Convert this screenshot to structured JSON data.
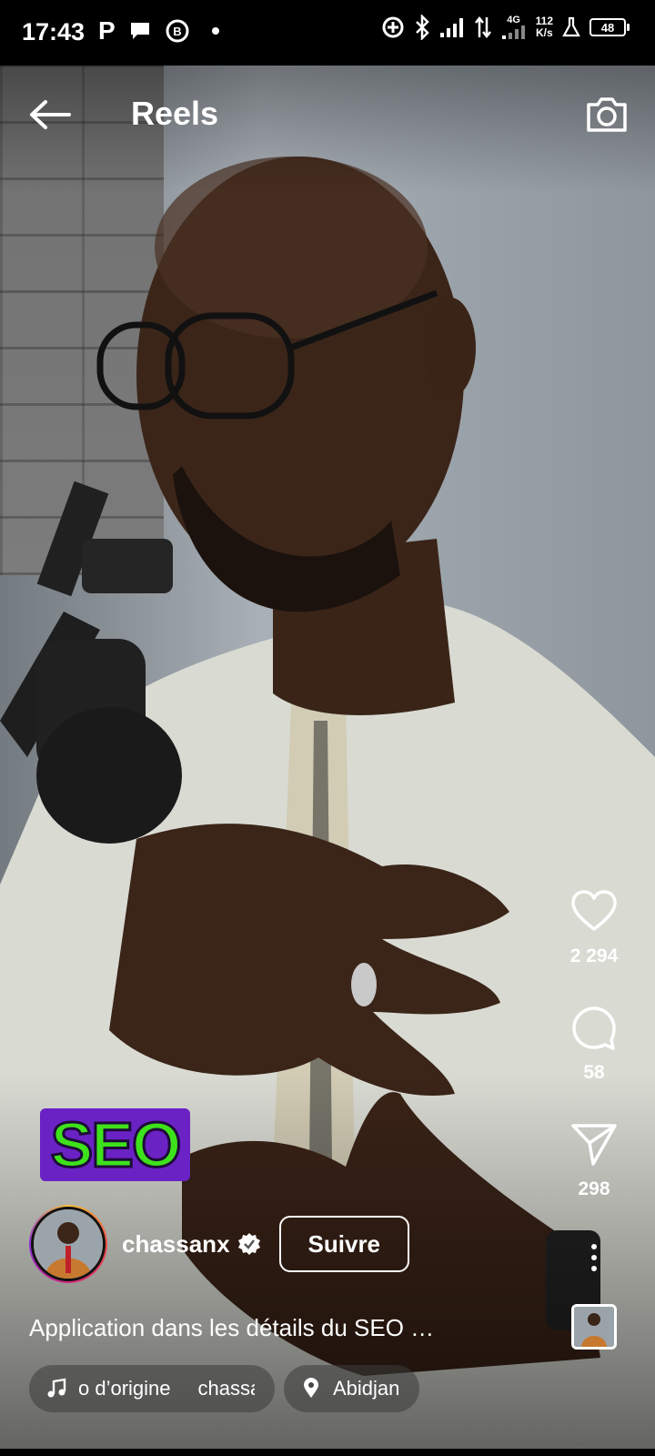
{
  "status_bar": {
    "time": "17:43",
    "left_icons": [
      "parking-icon",
      "chat-bubble-icon",
      "whatsapp-business-icon",
      "dot-icon"
    ],
    "net_speed_value": "112",
    "net_speed_unit": "K/s",
    "network_type": "4G",
    "battery_level": "48",
    "right_icons": [
      "data-saver-icon",
      "bluetooth-icon",
      "signal-icon",
      "data-arrows-icon",
      "signal-4g-icon",
      "lab-icon",
      "battery-icon"
    ]
  },
  "header": {
    "title": "Reels",
    "back_icon": "arrow-left-icon",
    "camera_icon": "camera-icon"
  },
  "actions": {
    "likes": "2 294",
    "comments": "58",
    "shares": "298"
  },
  "sticker": {
    "text": "SEO",
    "colors": {
      "background": "#6a22c4",
      "text": "#3ee21b"
    }
  },
  "author": {
    "username": "chassanx",
    "verified": true,
    "follow_label": "Suivre"
  },
  "caption": {
    "text": "Application dans les détails du SEO …"
  },
  "audio": {
    "title": "o d’origine",
    "artist": "chassa"
  },
  "location": {
    "name": "Abidjan"
  },
  "colors": {
    "accent_white": "#ffffff",
    "overlay_dark": "#000000"
  }
}
